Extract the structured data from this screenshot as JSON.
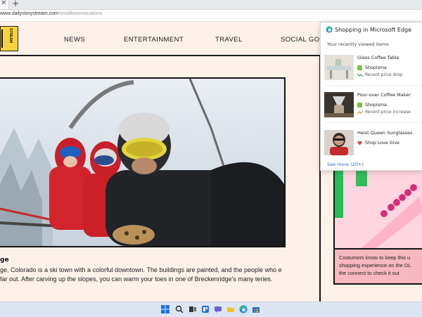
{
  "browser": {
    "tab_close": "✕",
    "new_tab": "+",
    "url_domain": "www.dailystorystream.com",
    "url_path": "/smalltownvacations"
  },
  "site": {
    "logo_text": "STREAM",
    "nav": [
      "NEWS",
      "ENTERTAINMENT",
      "TRAVEL",
      "SOCIAL GOOD"
    ]
  },
  "article": {
    "title": "ge",
    "body": "ge, Colorado is a ski town with a colorful downtown. The buildings are painted, and the people who e far out. After carving up the slopes, you can warm your toes in one of Breckenridge's many teries."
  },
  "sidebar": {
    "promo_lines": [
      "Costumers know to keep this u",
      "shopping experience on the DL",
      "the connect to check it out"
    ]
  },
  "shopping_panel": {
    "title": "Shopping in Microsoft Edge",
    "subtitle": "Your recently viewed items",
    "items": [
      {
        "name": "Glass Coffee Table",
        "store": "Shopisma",
        "trend": "Recent price drop"
      },
      {
        "name": "Pour-over Coffee Maker",
        "store": "Shopisma",
        "trend": "Recent price increase"
      },
      {
        "name": "Heist Queen Sunglasses",
        "store": "Shop Love Give",
        "trend": ""
      }
    ],
    "see_more": "See more (20+)"
  },
  "colors": {
    "page_bg": "#fdf1ea",
    "logo_yellow": "#f5d33c",
    "promo_pink": "#f7b8c1",
    "link_blue": "#2a63c8",
    "shopisma_green": "#7cc04b",
    "price_drop_green": "#2e8b57",
    "price_up_orange": "#d9822b"
  },
  "taskbar": {
    "icons": [
      "windows-start-icon",
      "search-icon",
      "task-view-icon",
      "widgets-icon",
      "chat-icon",
      "file-explorer-icon",
      "edge-icon",
      "store-icon"
    ]
  }
}
